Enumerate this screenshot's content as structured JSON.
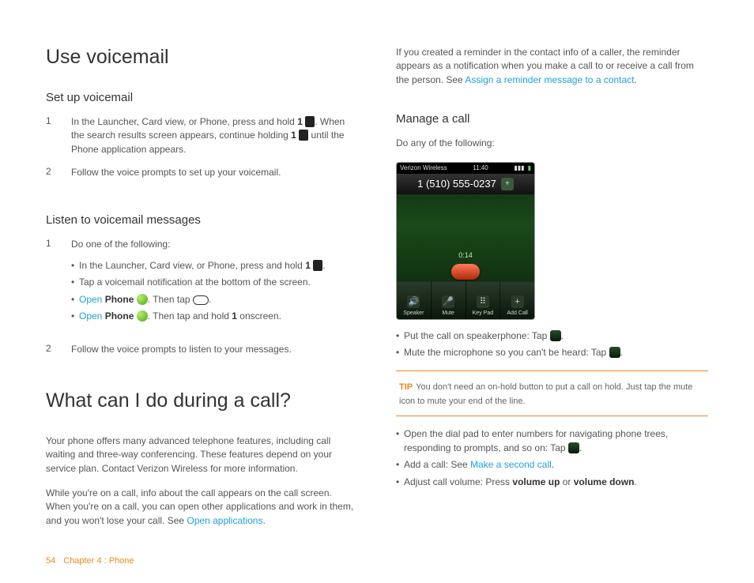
{
  "left": {
    "h_voicemail": "Use voicemail",
    "h_setup": "Set up voicemail",
    "setup_step1a": "In the Launcher, Card view, or Phone, press and hold ",
    "setup_step1b": ". When the search results screen appears, continue holding ",
    "setup_step1c": " until the Phone application appears.",
    "one": "1",
    "two": "2",
    "setup_step2": "Follow the voice prompts to set up your voicemail.",
    "h_listen": "Listen to voicemail messages",
    "listen_step1": "Do one of the following:",
    "bullet1a": "In the Launcher, Card view, or Phone, press and hold ",
    "bullet1b": ".",
    "bullet2": "Tap a voicemail notification at the bottom of the screen.",
    "bullet3_open": "Open",
    "bullet3_phone": "Phone",
    "bullet3_tail": ". Then tap ",
    "bullet4_tail": ". Then tap and hold ",
    "bullet4_one": "1",
    "bullet4_end": " onscreen.",
    "listen_step2": "Follow the voice prompts to listen to your messages.",
    "h_call": "What can I do during a call?",
    "p_call1": "Your phone offers many advanced telephone features, including call waiting and three-way conferencing. These features depend on your service plan. Contact Verizon Wireless for more information.",
    "p_call2a": "While you're on a call, info about the call appears on the call screen. When you're on a call, you can open other applications and work in them, and you won't lose your call. See ",
    "p_call2_link": "Open applications",
    "p_call2b": "."
  },
  "right": {
    "p_reminder_a": "If you created a reminder in the contact info of a caller, the reminder appears as a notification when you make a call to or receive a call from the person. See ",
    "p_reminder_link": "Assign a reminder message to a contact",
    "p_reminder_b": ".",
    "h_manage": "Manage a call",
    "p_doany": "Do any of the following:",
    "shot": {
      "carrier": "Verizon Wireless",
      "time": "11:40",
      "number": "1 (510) 555-0237",
      "duration": "0:14",
      "btn_speaker": "Speaker",
      "btn_mute": "Mute",
      "btn_keypad": "Key Pad",
      "btn_addcall": "Add Call"
    },
    "bul_speaker": "Put the call on speakerphone: Tap ",
    "bul_mute": "Mute the microphone so you can't be heard: Tap ",
    "period": ".",
    "tip_label": "TIP",
    "tip_text": "You don't need an on-hold button to put a call on hold. Just tap the mute icon to mute your end of the line.",
    "bul_dialpad": "Open the dial pad to enter numbers for navigating phone trees, responding to prompts, and so on: Tap ",
    "bul_addcall_a": "Add a call: See ",
    "bul_addcall_link": "Make a second call",
    "bul_addcall_b": ".",
    "bul_volume_a": "Adjust call volume: Press ",
    "bul_volume_up": "volume up",
    "bul_volume_or": " or ",
    "bul_volume_down": "volume down",
    "bul_volume_b": "."
  },
  "footer": {
    "page": "54",
    "chapter": "Chapter 4 : Phone"
  }
}
